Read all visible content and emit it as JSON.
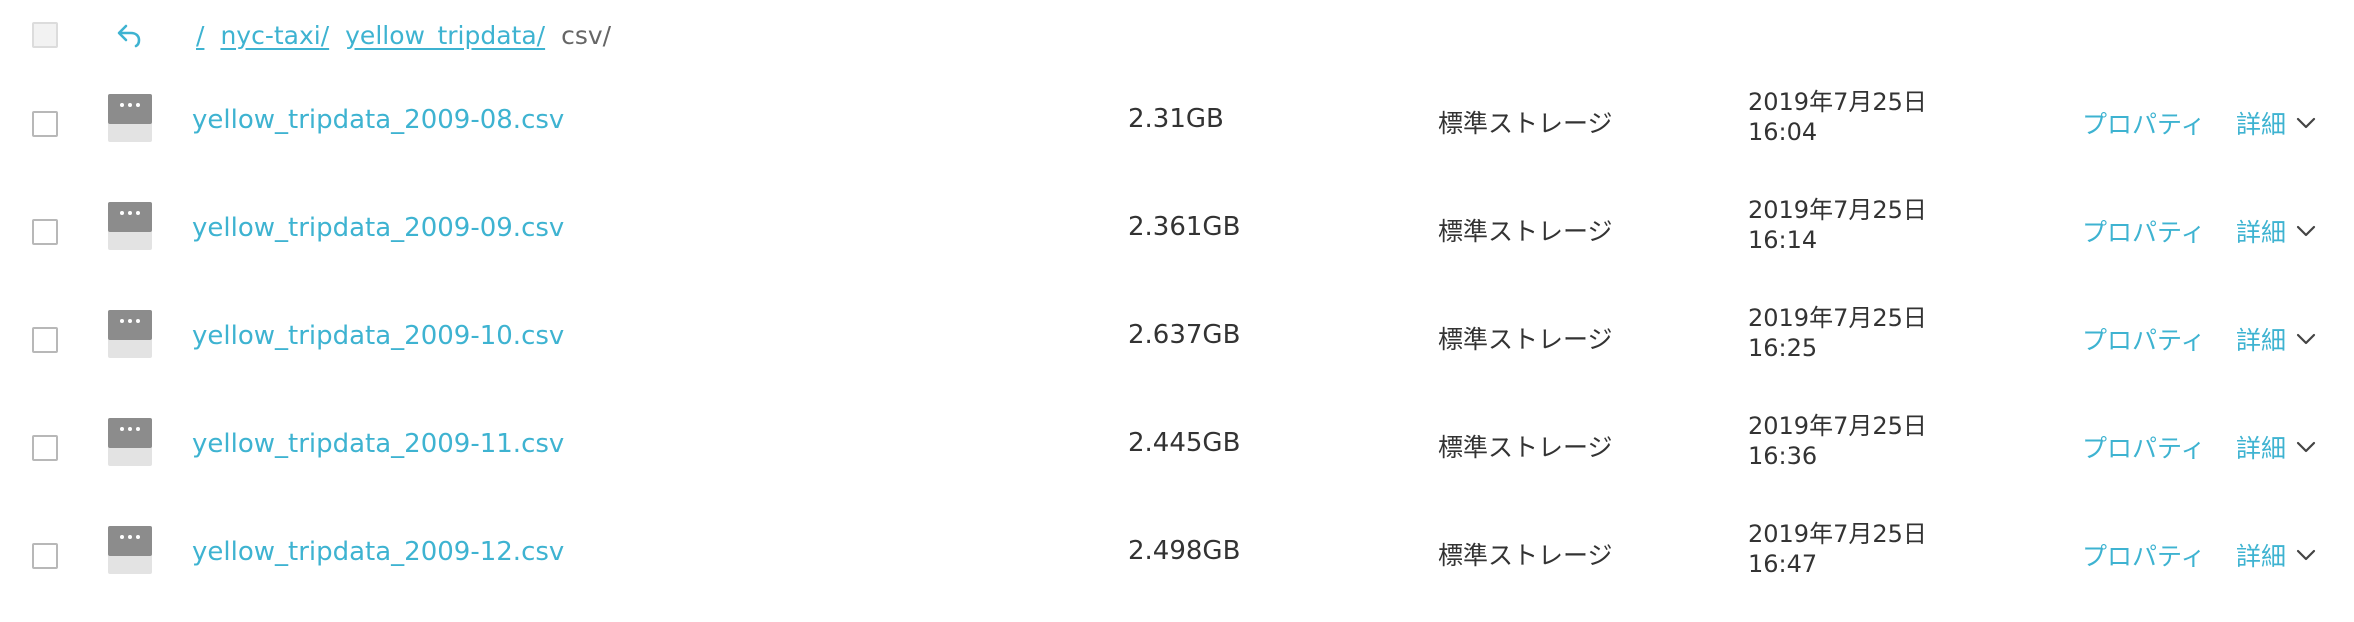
{
  "header": {
    "select_all_checked": false,
    "back_icon": "undo-arrow-icon",
    "breadcrumb": [
      {
        "label": "/",
        "link": true
      },
      {
        "label": "nyc-taxi/",
        "link": true
      },
      {
        "label": "yellow_tripdata/",
        "link": true
      },
      {
        "label": "csv/",
        "link": false
      }
    ]
  },
  "files": [
    {
      "name": "yellow_tripdata_2009-08.csv",
      "size": "2.31GB",
      "storage_class": "標準ストレージ",
      "modified_date": "2019年7月25日",
      "modified_time": "16:04",
      "properties_label": "プロパティ",
      "details_label": "詳細"
    },
    {
      "name": "yellow_tripdata_2009-09.csv",
      "size": "2.361GB",
      "storage_class": "標準ストレージ",
      "modified_date": "2019年7月25日",
      "modified_time": "16:14",
      "properties_label": "プロパティ",
      "details_label": "詳細"
    },
    {
      "name": "yellow_tripdata_2009-10.csv",
      "size": "2.637GB",
      "storage_class": "標準ストレージ",
      "modified_date": "2019年7月25日",
      "modified_time": "16:25",
      "properties_label": "プロパティ",
      "details_label": "詳細"
    },
    {
      "name": "yellow_tripdata_2009-11.csv",
      "size": "2.445GB",
      "storage_class": "標準ストレージ",
      "modified_date": "2019年7月25日",
      "modified_time": "16:36",
      "properties_label": "プロパティ",
      "details_label": "詳細"
    },
    {
      "name": "yellow_tripdata_2009-12.csv",
      "size": "2.498GB",
      "storage_class": "標準ストレージ",
      "modified_date": "2019年7月25日",
      "modified_time": "16:47",
      "properties_label": "プロパティ",
      "details_label": "詳細"
    }
  ],
  "icons": {
    "file": "file-icon",
    "chevron": "chevron-down-icon"
  },
  "colors": {
    "link": "#3eb3d1",
    "text": "#333333",
    "icon_gray": "#8c8c8c",
    "checkbox_border": "#b8b8b8"
  }
}
